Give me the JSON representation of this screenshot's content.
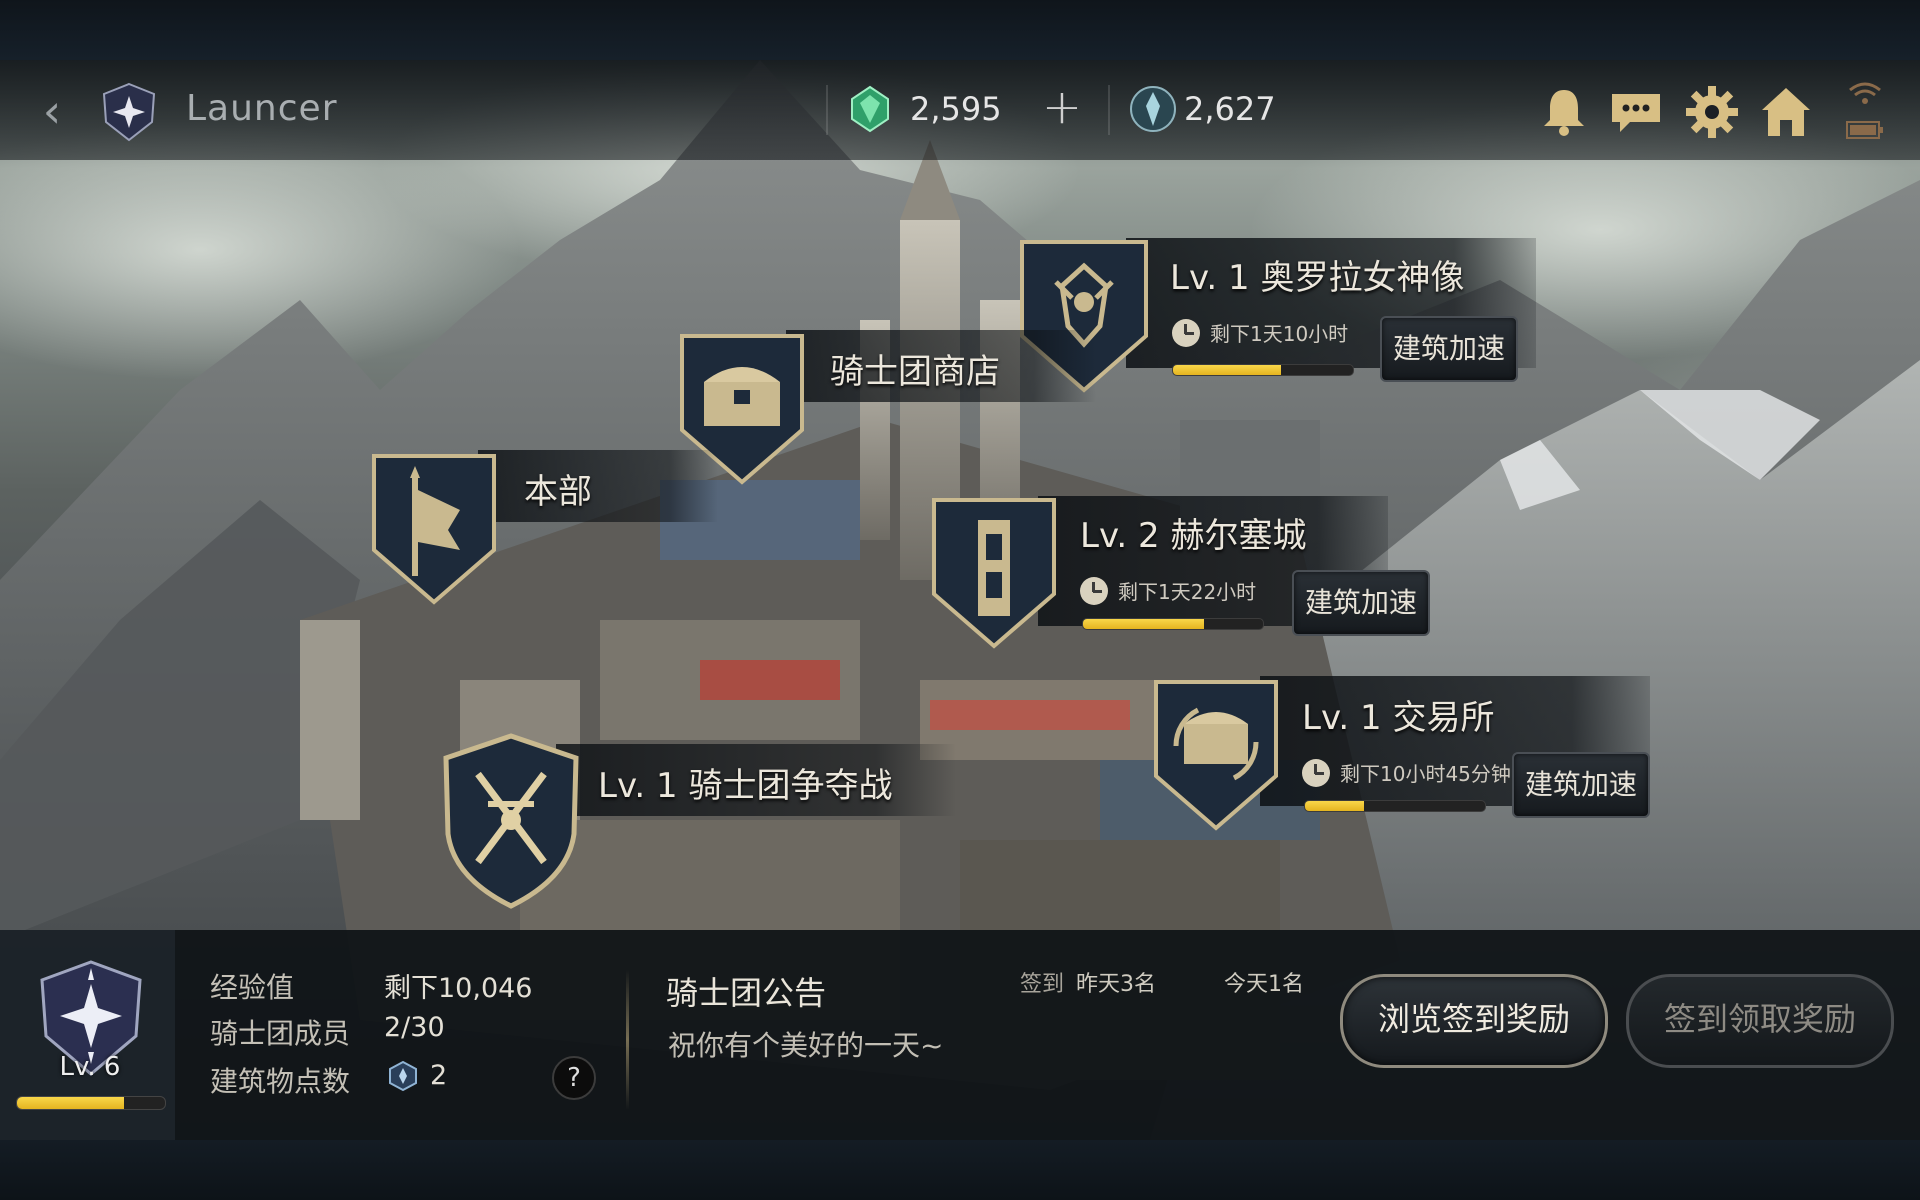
{
  "topbar": {
    "back_glyph": "‹",
    "title": "Launcer",
    "gems": "2,595",
    "add_glyph": "+",
    "orbs": "2,627",
    "icons": [
      "bell-icon",
      "chat-icon",
      "gear-icon",
      "home-icon",
      "wifi-icon",
      "battery-icon"
    ]
  },
  "buildings": {
    "statue": {
      "title": "Lv. 1  奥罗拉女神像",
      "timer": "剩下1天10小时",
      "progress": 0.6,
      "speedup": "建筑加速"
    },
    "shop": {
      "title": "骑士团商店"
    },
    "hq": {
      "title": "本部"
    },
    "castle": {
      "title": "Lv. 2  赫尔塞城",
      "timer": "剩下1天22小时",
      "progress": 0.67,
      "speedup": "建筑加速"
    },
    "exchange": {
      "title": "Lv. 1  交易所",
      "timer": "剩下10小时45分钟",
      "progress": 0.33,
      "speedup": "建筑加速"
    },
    "war": {
      "title": "Lv. 1  骑士团争夺战"
    }
  },
  "guild": {
    "level": "Lv. 6",
    "exp_progress": 0.72,
    "stats": {
      "exp_label": "经验值",
      "exp_value": "剩下10,046",
      "members_label": "骑士团成员",
      "members_value": "2/30",
      "points_label": "建筑物点数",
      "points_value": "2"
    },
    "help_glyph": "?"
  },
  "notice": {
    "title": "骑士团公告",
    "body": "祝你有个美好的一天~",
    "checkin_label": "签到",
    "yesterday": "昨天3名",
    "today": "今天1名"
  },
  "buttons": {
    "browse_rewards": "浏览签到奖励",
    "claim_rewards": "签到领取奖励"
  },
  "colors": {
    "progress_yellow": "#f2c934",
    "shield_dark": "#1d2a3a",
    "shield_border": "#c9b98f",
    "text_light": "#ece7dc"
  }
}
